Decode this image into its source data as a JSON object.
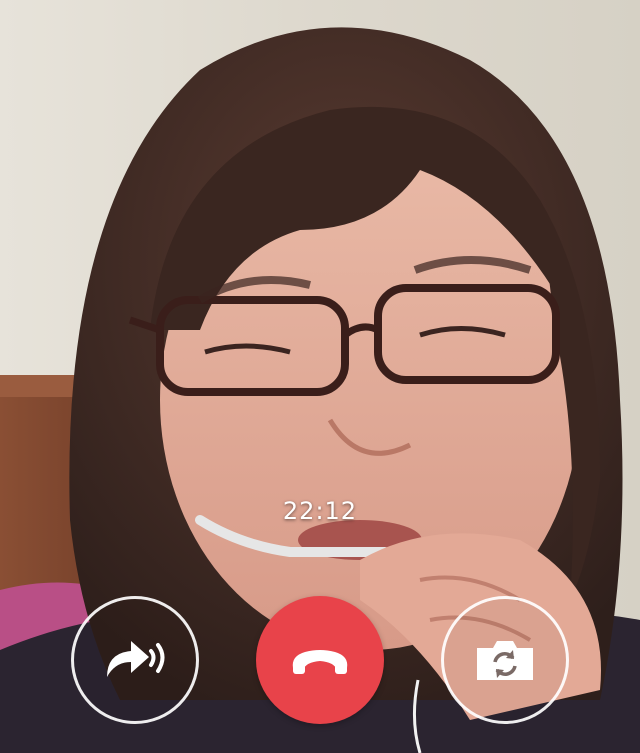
{
  "call": {
    "timer": "22:12"
  },
  "controls": {
    "speaker_icon": "speaker-arrow-icon",
    "end_icon": "hang-up-icon",
    "switch_icon": "camera-switch-icon"
  },
  "colors": {
    "end_button": "#e8434a",
    "button_outline": "#ffffff",
    "timer_text": "#ffffff"
  }
}
